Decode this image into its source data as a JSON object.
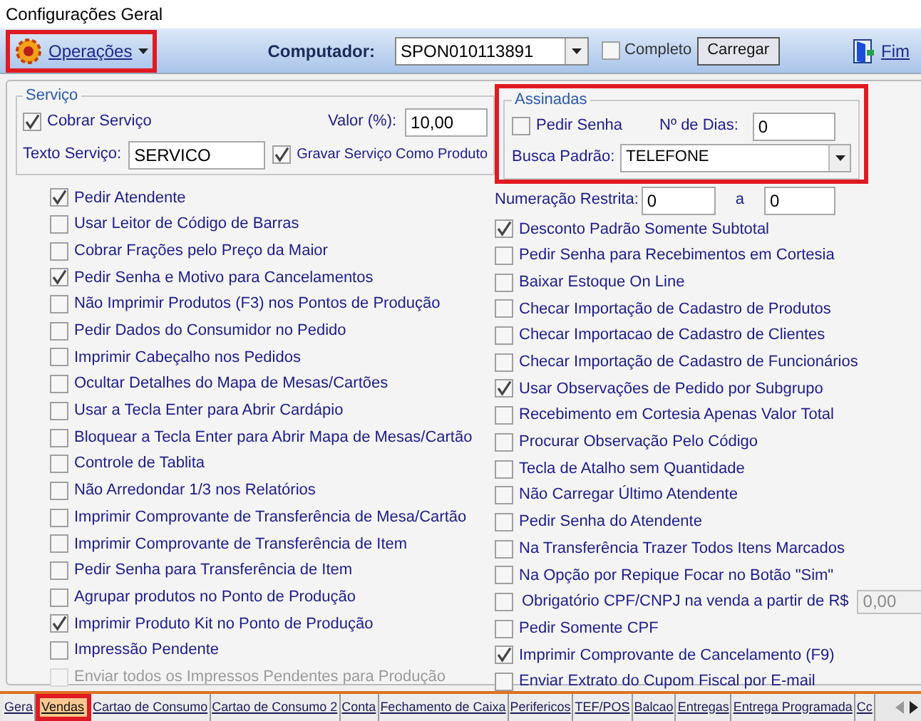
{
  "window": {
    "title": "Configurações Geral"
  },
  "toolbar": {
    "operations_menu": {
      "label": "Operações",
      "highlighted": true
    },
    "computer_label": "Computador:",
    "computer_value": "SPON010113891",
    "complete": {
      "label": "Completo",
      "checked": false
    },
    "load_button": "Carregar",
    "exit_button": "Fim"
  },
  "servico": {
    "title": "Serviço",
    "cobrar": {
      "label": "Cobrar Serviço",
      "checked": true
    },
    "valor_label": "Valor (%):",
    "valor": "10,00",
    "texto_label": "Texto Serviço:",
    "texto": "SERVICO",
    "gravar": {
      "label": "Gravar Serviço Como Produto",
      "checked": true
    }
  },
  "assinadas": {
    "title": "Assinadas",
    "highlighted": true,
    "pedir_senha": {
      "label": "Pedir Senha",
      "checked": false
    },
    "dias_label": "Nº de Dias:",
    "dias": "0",
    "busca_label": "Busca Padrão:",
    "busca": "TELEFONE"
  },
  "numeracao": {
    "label": "Numeração Restrita:",
    "from": "0",
    "sep": "a",
    "to": "0"
  },
  "left_options": [
    {
      "label": "Pedir Atendente",
      "checked": true,
      "disabled": false
    },
    {
      "label": "Usar Leitor de Código de Barras",
      "checked": false,
      "disabled": false
    },
    {
      "label": "Cobrar Frações pelo Preço da Maior",
      "checked": false,
      "disabled": false
    },
    {
      "label": "Pedir Senha e Motivo para Cancelamentos",
      "checked": true,
      "disabled": false
    },
    {
      "label": "Não Imprimir Produtos (F3) nos Pontos de Produção",
      "checked": false,
      "disabled": false
    },
    {
      "label": "Pedir Dados do Consumidor no Pedido",
      "checked": false,
      "disabled": false
    },
    {
      "label": "Imprimir Cabeçalho nos Pedidos",
      "checked": false,
      "disabled": false
    },
    {
      "label": "Ocultar Detalhes do Mapa de Mesas/Cartões",
      "checked": false,
      "disabled": false
    },
    {
      "label": "Usar a Tecla Enter para Abrir Cardápio",
      "checked": false,
      "disabled": false
    },
    {
      "label": "Bloquear a Tecla Enter para Abrir Mapa de Mesas/Cartão",
      "checked": false,
      "disabled": false
    },
    {
      "label": "Controle de Tablita",
      "checked": false,
      "disabled": false
    },
    {
      "label": "Não Arredondar 1/3 nos Relatórios",
      "checked": false,
      "disabled": false
    },
    {
      "label": "Imprimir Comprovante de Transferência de Mesa/Cartão",
      "checked": false,
      "disabled": false
    },
    {
      "label": "Imprimir Comprovante de Transferência de Item",
      "checked": false,
      "disabled": false
    },
    {
      "label": "Pedir Senha para Transferência de Item",
      "checked": false,
      "disabled": false
    },
    {
      "label": "Agrupar produtos no Ponto de Produção",
      "checked": false,
      "disabled": false
    },
    {
      "label": "Imprimir Produto Kit no Ponto de Produção",
      "checked": true,
      "disabled": false
    },
    {
      "label": "Impressão Pendente",
      "checked": false,
      "disabled": false
    },
    {
      "label": "Enviar todos os Impressos Pendentes para Produção",
      "checked": false,
      "disabled": true
    }
  ],
  "right_options": [
    {
      "kind": "check",
      "label": "Desconto Padrão Somente Subtotal",
      "checked": true
    },
    {
      "kind": "check",
      "label": "Pedir Senha para Recebimentos em Cortesia",
      "checked": false
    },
    {
      "kind": "check",
      "label": "Baixar Estoque On Line",
      "checked": false
    },
    {
      "kind": "check",
      "label": "Checar Importação de Cadastro de Produtos",
      "checked": false
    },
    {
      "kind": "check",
      "label": "Checar Importacao de Cadastro de Clientes",
      "checked": false
    },
    {
      "kind": "check",
      "label": "Checar Importação de Cadastro de Funcionários",
      "checked": false
    },
    {
      "kind": "check",
      "label": "Usar Observações de Pedido por Subgrupo",
      "checked": true
    },
    {
      "kind": "check",
      "label": "Recebimento em Cortesia Apenas Valor Total",
      "checked": false
    },
    {
      "kind": "check",
      "label": "Procurar Observação Pelo Código",
      "checked": false
    },
    {
      "kind": "check",
      "label": "Tecla de Atalho sem Quantidade",
      "checked": false
    },
    {
      "kind": "check",
      "label": "Não Carregar Último Atendente",
      "checked": false
    },
    {
      "kind": "check",
      "label": "Pedir Senha do Atendente",
      "checked": false
    },
    {
      "kind": "check",
      "label": "Na Transferência Trazer Todos Itens Marcados",
      "checked": false
    },
    {
      "kind": "check",
      "label": "Na Opção por Repique Focar no Botão \"Sim\"",
      "checked": false
    },
    {
      "kind": "check_field",
      "label": "Obrigatório CPF/CNPJ na venda a partir de R$",
      "checked": false,
      "value": "0,00"
    },
    {
      "kind": "check",
      "label": "Pedir Somente CPF",
      "checked": false
    },
    {
      "kind": "check",
      "label": "Imprimir Comprovante de Cancelamento (F9)",
      "checked": true
    },
    {
      "kind": "check",
      "label": "Enviar Extrato do Cupom Fiscal por E-mail",
      "checked": false
    }
  ],
  "tabs": [
    {
      "label": "Gera",
      "selected": false,
      "highlighted": false
    },
    {
      "label": "Vendas",
      "selected": true,
      "highlighted": true
    },
    {
      "label": "Cartao de Consumo",
      "selected": false,
      "highlighted": false
    },
    {
      "label": "Cartao de Consumo 2",
      "selected": false,
      "highlighted": false
    },
    {
      "label": "Conta",
      "selected": false,
      "highlighted": false
    },
    {
      "label": "Fechamento de Caixa",
      "selected": false,
      "highlighted": false
    },
    {
      "label": "Perifericos",
      "selected": false,
      "highlighted": false
    },
    {
      "label": "TEF/POS",
      "selected": false,
      "highlighted": false
    },
    {
      "label": "Balcao",
      "selected": false,
      "highlighted": false
    },
    {
      "label": "Entregas",
      "selected": false,
      "highlighted": false
    },
    {
      "label": "Entrega Programada",
      "selected": false,
      "highlighted": false
    },
    {
      "label": "Cc",
      "selected": false,
      "highlighted": false
    }
  ]
}
